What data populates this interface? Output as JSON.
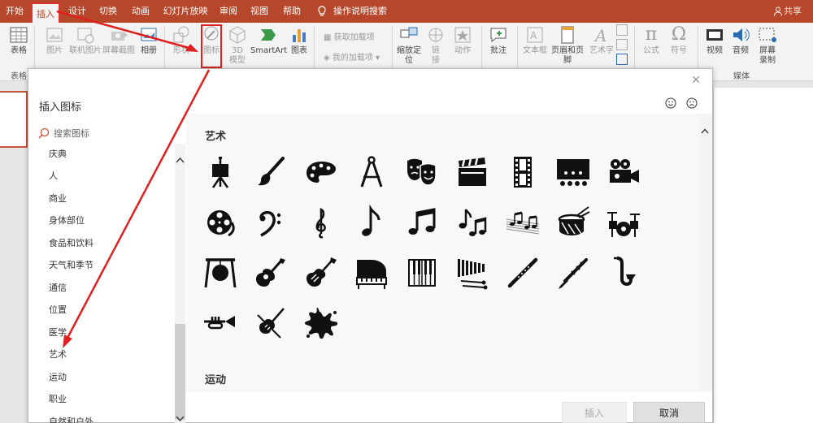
{
  "tabs": [
    "开始",
    "插入",
    "设计",
    "切换",
    "动画",
    "幻灯片放映",
    "审阅",
    "视图",
    "帮助"
  ],
  "tell_me": "操作说明搜索",
  "share": "共享",
  "ribbon": {
    "table": "表格",
    "picture": "图片",
    "online_picture": "联机图片",
    "screenshot": "屏幕截图",
    "album": "相册",
    "shapes": "形状",
    "icons": "图标",
    "model3d_1": "3D",
    "model3d_2": "模型",
    "smartart": "SmartArt",
    "chart": "图表",
    "get_addins": "获取加载项",
    "my_addins": "我的加载项",
    "zoom_1": "缩放定",
    "zoom_2": "位",
    "link_1": "链",
    "link_2": "接",
    "action": "动作",
    "comment": "批注",
    "textbox": "文本框",
    "header_footer": "页眉和页脚",
    "wordart": "艺术字",
    "equation": "公式",
    "symbol": "符号",
    "video": "视频",
    "audio": "音频",
    "screen_rec_1": "屏幕",
    "screen_rec_2": "录制",
    "group_table": "表格",
    "group_media": "媒体"
  },
  "dialog": {
    "title": "插入图标",
    "search_placeholder": "搜索图标",
    "categories": [
      "庆典",
      "人",
      "商业",
      "身体部位",
      "食品和饮料",
      "天气和季节",
      "通信",
      "位置",
      "医学",
      "艺术",
      "运动",
      "职业",
      "自然和户外"
    ],
    "section_art": "艺术",
    "section_sport": "运动",
    "insert": "插入",
    "cancel": "取消",
    "icons": [
      "easel-icon",
      "paintbrush-icon",
      "palette-icon",
      "compass-icon",
      "theater-masks-icon",
      "clapperboard-icon",
      "film-strip-icon",
      "theater-stage-icon",
      "movie-camera-icon",
      "film-reel-icon",
      "bass-clef-icon",
      "treble-clef-icon",
      "eighth-note-icon",
      "beamed-notes-icon",
      "beamed-notes-2-icon",
      "sheet-music-icon",
      "drum-icon",
      "drum-kit-icon",
      "gong-icon",
      "acoustic-guitar-icon",
      "electric-guitar-icon",
      "grand-piano-icon",
      "piano-keys-icon",
      "xylophone-icon",
      "flute-icon",
      "clarinet-icon",
      "saxophone-icon",
      "trumpet-icon",
      "violin-icon",
      "paint-splat-icon"
    ]
  },
  "colors": {
    "accent": "#b7472a",
    "annotation": "#e02020"
  }
}
